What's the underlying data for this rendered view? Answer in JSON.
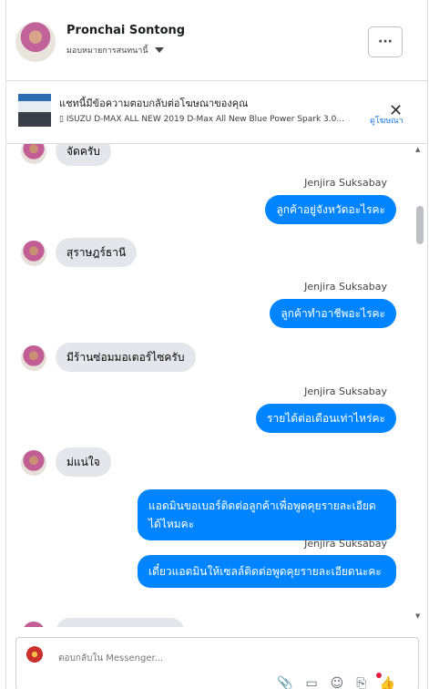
{
  "header": {
    "name": "Pronchai Sontong",
    "subtitle": "มอบหมายการสนทนานี้",
    "more_label": "···"
  },
  "ad_banner": {
    "title": "แชทนี้มีข้อความตอบกลับต่อโฆษณาของคุณ",
    "description": "▯ ISUZU D-MAX ALL NEW 2019 D-Max All New Blue Power Spark 3.0...",
    "link": "ดูโฆษณา",
    "close": "✕"
  },
  "messages": [
    {
      "dir": "in",
      "text": "จัดครับ"
    },
    {
      "dir": "out",
      "sender": "Jenjira Suksabay",
      "text": "ลูกค้าอยู่จังหวัดอะไรคะ"
    },
    {
      "dir": "in",
      "text": "สุราษฎร์ธานี"
    },
    {
      "dir": "out",
      "sender": "Jenjira Suksabay",
      "text": "ลูกค้าทำอาชีพอะไรคะ"
    },
    {
      "dir": "in",
      "text": "มีร้านซ่อมมอเตอร์ไซครับ"
    },
    {
      "dir": "out",
      "sender": "Jenjira Suksabay",
      "text": "รายได้ต่อเดือนเท่าไหร่คะ"
    },
    {
      "dir": "in",
      "text": "ม่แน่ใจ"
    },
    {
      "dir": "out",
      "text": "แอดมินขอเบอร์ติดต่อลูกค้าเพื่อพูดคุยรายละเอียดได้ไหมคะ"
    },
    {
      "dir": "out",
      "sender": "Jenjira Suksabay",
      "text": "เดี๋ยวแอดมินให้เซลล์ติดต่อพูดคุยรายละเอียดนะคะ"
    }
  ],
  "composer": {
    "placeholder": "ตอบกลับใน Messenger...",
    "icons": [
      "paperclip-icon",
      "saved-reply-icon",
      "emoji-icon",
      "label-icon",
      "like-icon"
    ]
  },
  "colors": {
    "bubble_out": "#0084ff",
    "bubble_in": "#e4e6eb",
    "link": "#1877f2"
  }
}
